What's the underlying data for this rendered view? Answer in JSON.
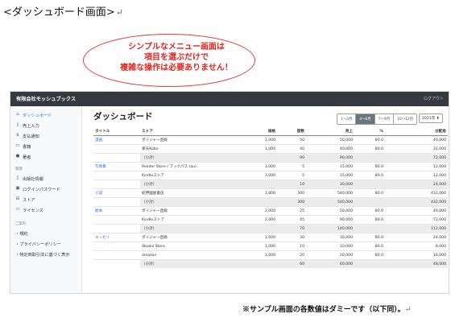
{
  "doc": {
    "title": "<ダッシュボード画面>",
    "return_mark": "↵",
    "footnote": "※サンプル画面の各数値はダミーです（以下同）。"
  },
  "callout": {
    "lines": [
      "シンプルなメニュー画面は",
      "項目を選ぶだけで",
      "複雑な操作は必要ありません！"
    ]
  },
  "app": {
    "brand": "有限会社モッシュブックス",
    "logout": "ログアウト",
    "sidebar": {
      "items": [
        {
          "label": "ダッシュボード",
          "icon": "home-icon"
        },
        {
          "label": "売上入力",
          "icon": "file-icon"
        },
        {
          "label": "支払通知",
          "icon": "dollar-icon"
        },
        {
          "label": "書籍",
          "icon": "book-icon"
        },
        {
          "label": "著者",
          "icon": "user-icon"
        }
      ],
      "section_admin": "管理",
      "admin_items": [
        {
          "label": "出版社情報",
          "icon": "document-icon"
        },
        {
          "label": "ログインパスワード",
          "icon": "lock-icon"
        },
        {
          "label": "ストア",
          "icon": "store-icon"
        },
        {
          "label": "ライセンス",
          "icon": "card-icon"
        }
      ],
      "section_other": "ご案内",
      "other_items": [
        {
          "label": "・規約"
        },
        {
          "label": "・プライバシーポリシー"
        },
        {
          "label": "・特定商取引法に基づく表示"
        }
      ]
    },
    "main": {
      "title": "ダッシュボード",
      "quarters": [
        "1〜3月",
        "4〜6月",
        "7〜9月",
        "10〜12月"
      ],
      "active_quarter_index": 1,
      "year": "2021年 ⬍",
      "columns": [
        "タイトル",
        "ストア",
        "価格",
        "部数",
        "売上",
        "%",
        "分配金"
      ],
      "rows": [
        {
          "title": "漫画",
          "store": "ポイジャー直販",
          "price": "1,000",
          "qty": "50",
          "sales": "50,000",
          "pct": "80.0",
          "dist": "40,000"
        },
        {
          "title": "",
          "store": "楽天Kobo",
          "price": "1,000",
          "qty": "40",
          "sales": "40,000",
          "pct": "80.0",
          "dist": "32,000"
        },
        {
          "title": "",
          "store": "（小計）",
          "price": "",
          "qty": "90",
          "sales": "90,000",
          "pct": "",
          "dist": "72,000",
          "subtotal": true
        },
        {
          "title": "写真集",
          "store": "Reader Store / ブックパス (au)",
          "price": "3,000",
          "qty": "5",
          "sales": "15,000",
          "pct": "80.0",
          "dist": "12,000"
        },
        {
          "title": "",
          "store": "Kindleストア",
          "price": "3,000",
          "qty": "5",
          "sales": "15,000",
          "pct": "80.0",
          "dist": "12,000"
        },
        {
          "title": "",
          "store": "（小計）",
          "price": "",
          "qty": "10",
          "sales": "30,000",
          "pct": "",
          "dist": "24,000",
          "subtotal": true
        },
        {
          "title": "小説",
          "store": "紀伊國屋書店",
          "price": "1,800",
          "qty": "300",
          "sales": "540,000",
          "pct": "80.0",
          "dist": "432,000"
        },
        {
          "title": "",
          "store": "（小計）",
          "price": "",
          "qty": "300",
          "sales": "540,000",
          "pct": "",
          "dist": "432,000",
          "subtotal": true
        },
        {
          "title": "絵本",
          "store": "ポイジャー直販",
          "price": "2,000",
          "qty": "25",
          "sales": "50,000",
          "pct": "80.0",
          "dist": "40,000"
        },
        {
          "title": "",
          "store": "Kindleストア",
          "price": "2,000",
          "qty": "45",
          "sales": "90,000",
          "pct": "80.0",
          "dist": "72,000"
        },
        {
          "title": "",
          "store": "（小計）",
          "price": "",
          "qty": "70",
          "sales": "140,000",
          "pct": "",
          "dist": "112,000",
          "subtotal": true
        },
        {
          "title": "エッセイ",
          "store": "ポイジャー直販",
          "price": "1,000",
          "qty": "30",
          "sales": "30,000",
          "pct": "80.0",
          "dist": "24,000"
        },
        {
          "title": "",
          "store": "iBooks Store",
          "price": "1,000",
          "qty": "10",
          "sales": "10,000",
          "pct": "80.0",
          "dist": "8,000"
        },
        {
          "title": "",
          "store": "amazon",
          "price": "1,000",
          "qty": "20",
          "sales": "20,000",
          "pct": "80.0",
          "dist": "16,000"
        },
        {
          "title": "",
          "store": "（小計）",
          "price": "",
          "qty": "60",
          "sales": "60,000",
          "pct": "",
          "dist": "48,000",
          "subtotal": true
        }
      ]
    }
  }
}
